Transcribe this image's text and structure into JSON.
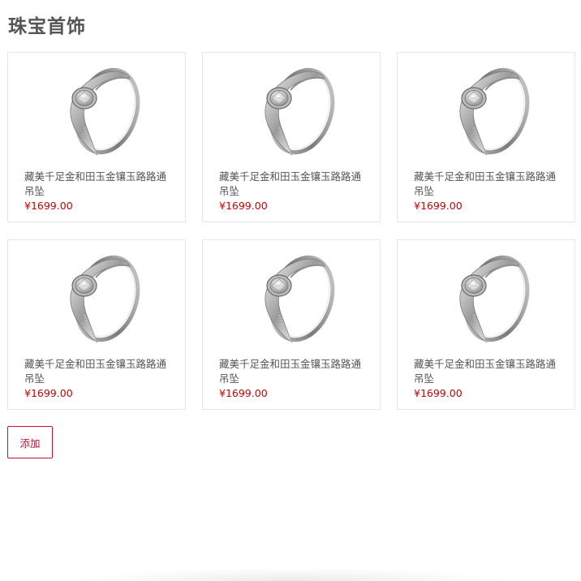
{
  "section": {
    "title": "珠宝首饰"
  },
  "products": [
    {
      "name": "藏美千足金和田玉金镶玉路路通吊坠",
      "price": "¥1699.00",
      "image_icon": "ring-icon"
    },
    {
      "name": "藏美千足金和田玉金镶玉路路通吊坠",
      "price": "¥1699.00",
      "image_icon": "ring-icon"
    },
    {
      "name": "藏美千足金和田玉金镶玉路路通吊坠",
      "price": "¥1699.00",
      "image_icon": "ring-icon"
    },
    {
      "name": "藏美千足金和田玉金镶玉路路通吊坠",
      "price": "¥1699.00",
      "image_icon": "ring-icon"
    },
    {
      "name": "藏美千足金和田玉金镶玉路路通吊坠",
      "price": "¥1699.00",
      "image_icon": "ring-icon"
    },
    {
      "name": "藏美千足金和田玉金镶玉路路通吊坠",
      "price": "¥1699.00",
      "image_icon": "ring-icon"
    }
  ],
  "actions": {
    "add_label": "添加"
  },
  "colors": {
    "accent": "#c8102e",
    "price": "#cc0000",
    "text": "#555555",
    "border": "#e6e6e6"
  }
}
